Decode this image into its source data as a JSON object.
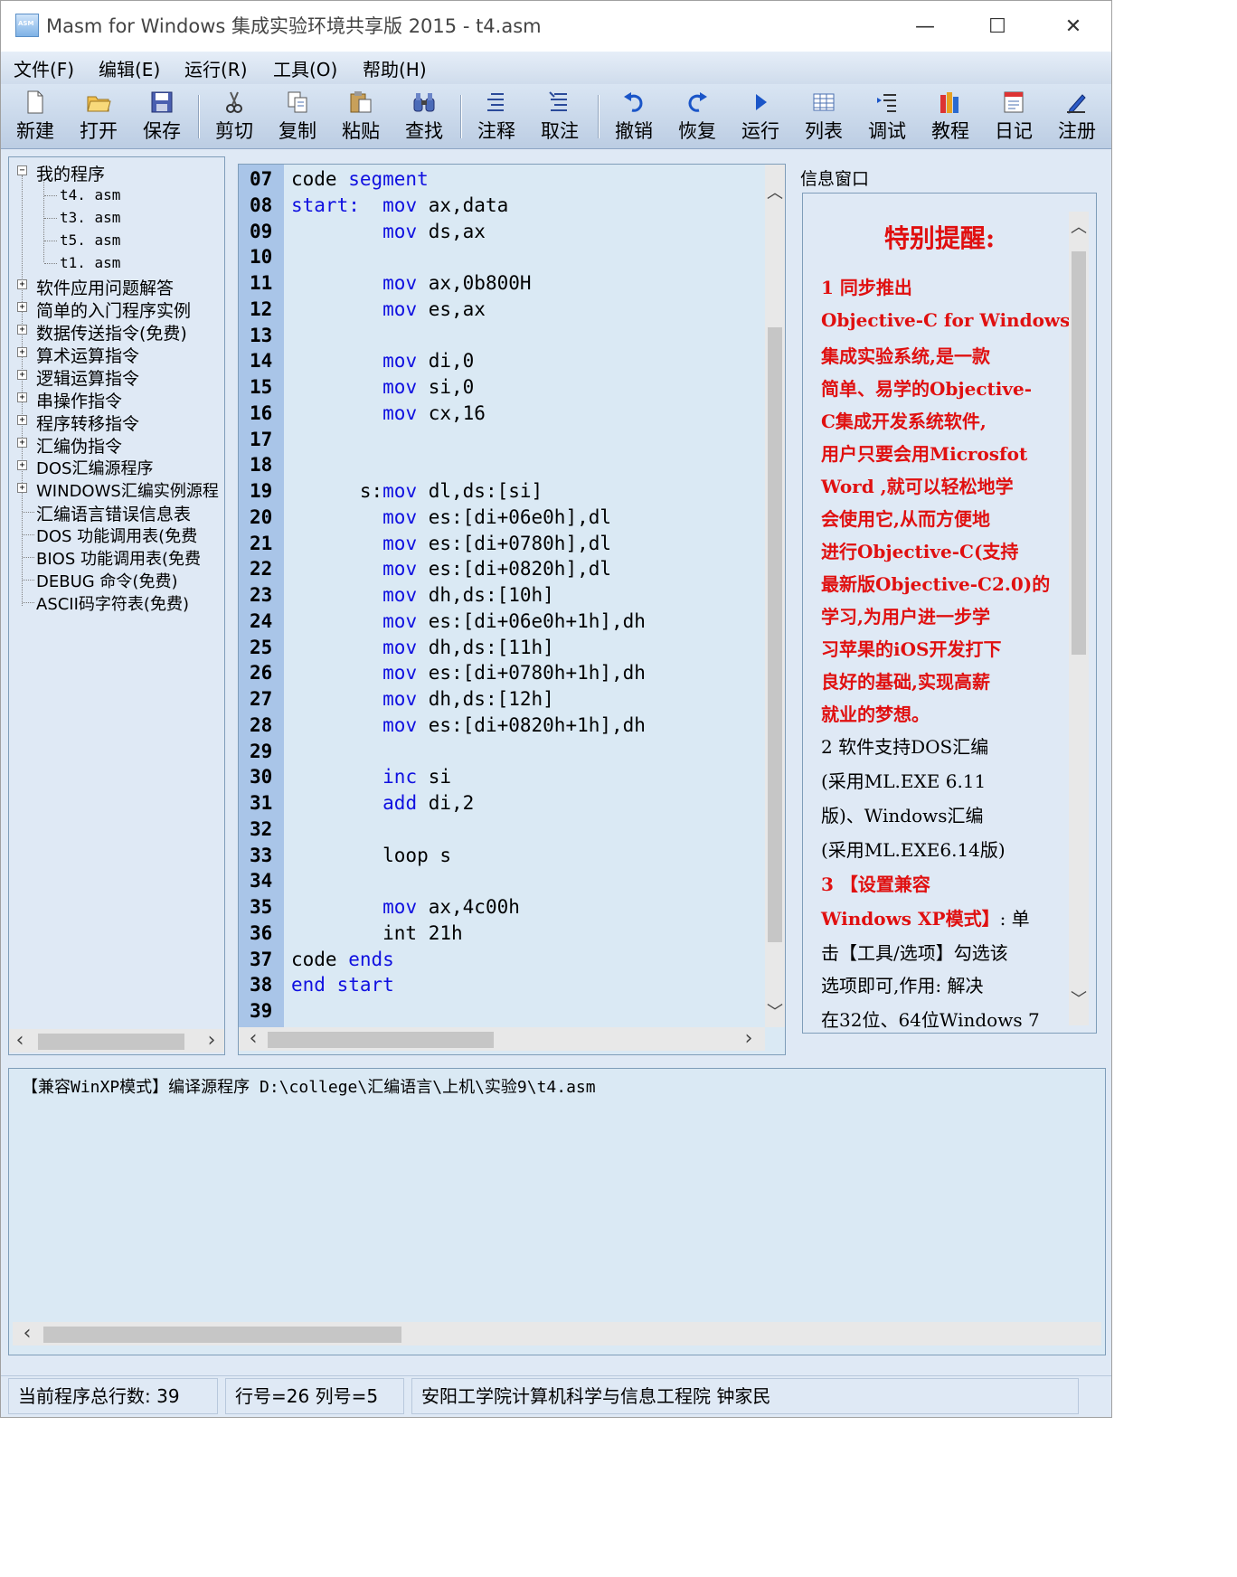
{
  "window": {
    "title": "Masm for Windows 集成实验环境共享版 2015 - t4.asm",
    "icon_text": "ASM",
    "controls": {
      "minimize": "—",
      "maximize": "☐",
      "close": "✕"
    }
  },
  "menu": [
    "文件(F)",
    "编辑(E)",
    "运行(R)",
    "工具(O)",
    "帮助(H)"
  ],
  "toolbar": [
    {
      "label": "新建",
      "icon": "new-file-icon"
    },
    {
      "label": "打开",
      "icon": "open-folder-icon"
    },
    {
      "label": "保存",
      "icon": "save-disk-icon"
    },
    {
      "label": "剪切",
      "icon": "scissors-icon"
    },
    {
      "label": "复制",
      "icon": "copy-icon"
    },
    {
      "label": "粘贴",
      "icon": "paste-icon"
    },
    {
      "label": "查找",
      "icon": "binoculars-icon"
    },
    {
      "label": "注释",
      "icon": "comment-icon"
    },
    {
      "label": "取注",
      "icon": "uncomment-icon"
    },
    {
      "label": "撤销",
      "icon": "undo-icon"
    },
    {
      "label": "恢复",
      "icon": "redo-icon"
    },
    {
      "label": "运行",
      "icon": "run-icon"
    },
    {
      "label": "列表",
      "icon": "list-icon"
    },
    {
      "label": "调试",
      "icon": "debug-icon"
    },
    {
      "label": "教程",
      "icon": "books-icon"
    },
    {
      "label": "日记",
      "icon": "diary-icon"
    },
    {
      "label": "注册",
      "icon": "register-pen-icon"
    }
  ],
  "tree": {
    "root": "我的程序",
    "files": [
      "t4. asm",
      "t3. asm",
      "t5. asm",
      "t1. asm"
    ],
    "folders": [
      "软件应用问题解答",
      "简单的入门程序实例",
      "数据传送指令(免费)",
      "算术运算指令",
      "逻辑运算指令",
      "串操作指令",
      "程序转移指令",
      "汇编伪指令",
      "DOS汇编源程序",
      "WINDOWS汇编实例源程"
    ],
    "leaves": [
      "汇编语言错误信息表",
      "DOS 功能调用表(免费",
      "BIOS 功能调用表(免费",
      "DEBUG 命令(免费)",
      "ASCII码字符表(免费)"
    ]
  },
  "editor": {
    "lines": [
      {
        "n": "07",
        "t": [
          [
            "code ",
            ""
          ],
          [
            "segment",
            "kw"
          ]
        ]
      },
      {
        "n": "08",
        "t": [
          [
            "start:",
            "kw"
          ],
          [
            "  ",
            ""
          ],
          [
            "mov",
            "kw"
          ],
          [
            " ax,data",
            ""
          ]
        ]
      },
      {
        "n": "09",
        "t": [
          [
            "        ",
            ""
          ],
          [
            "mov",
            "kw"
          ],
          [
            " ds,ax",
            ""
          ]
        ]
      },
      {
        "n": "10",
        "t": []
      },
      {
        "n": "11",
        "t": [
          [
            "        ",
            ""
          ],
          [
            "mov",
            "kw"
          ],
          [
            " ax,0b800H",
            ""
          ]
        ]
      },
      {
        "n": "12",
        "t": [
          [
            "        ",
            ""
          ],
          [
            "mov",
            "kw"
          ],
          [
            " es,ax",
            ""
          ]
        ]
      },
      {
        "n": "13",
        "t": []
      },
      {
        "n": "14",
        "t": [
          [
            "        ",
            ""
          ],
          [
            "mov",
            "kw"
          ],
          [
            " di,0",
            ""
          ]
        ]
      },
      {
        "n": "15",
        "t": [
          [
            "        ",
            ""
          ],
          [
            "mov",
            "kw"
          ],
          [
            " si,0",
            ""
          ]
        ]
      },
      {
        "n": "16",
        "t": [
          [
            "        ",
            ""
          ],
          [
            "mov",
            "kw"
          ],
          [
            " cx,16",
            ""
          ]
        ]
      },
      {
        "n": "17",
        "t": []
      },
      {
        "n": "18",
        "t": []
      },
      {
        "n": "19",
        "t": [
          [
            "      s:",
            ""
          ],
          [
            "mov",
            "kw"
          ],
          [
            " dl,ds:[si]",
            ""
          ]
        ]
      },
      {
        "n": "20",
        "t": [
          [
            "        ",
            ""
          ],
          [
            "mov",
            "kw"
          ],
          [
            " es:[di+06e0h],dl",
            ""
          ]
        ]
      },
      {
        "n": "21",
        "t": [
          [
            "        ",
            ""
          ],
          [
            "mov",
            "kw"
          ],
          [
            " es:[di+0780h],dl",
            ""
          ]
        ]
      },
      {
        "n": "22",
        "t": [
          [
            "        ",
            ""
          ],
          [
            "mov",
            "kw"
          ],
          [
            " es:[di+0820h],dl",
            ""
          ]
        ]
      },
      {
        "n": "23",
        "t": [
          [
            "        ",
            ""
          ],
          [
            "mov",
            "kw"
          ],
          [
            " dh,ds:[10h]",
            ""
          ]
        ]
      },
      {
        "n": "24",
        "t": [
          [
            "        ",
            ""
          ],
          [
            "mov",
            "kw"
          ],
          [
            " es:[di+06e0h+1h],dh",
            ""
          ]
        ]
      },
      {
        "n": "25",
        "t": [
          [
            "        ",
            ""
          ],
          [
            "mov",
            "kw"
          ],
          [
            " dh,ds:[11h]",
            ""
          ]
        ]
      },
      {
        "n": "26",
        "t": [
          [
            "        ",
            ""
          ],
          [
            "mov",
            "kw"
          ],
          [
            " es:[di+0780h+1h],dh",
            ""
          ]
        ]
      },
      {
        "n": "27",
        "t": [
          [
            "        ",
            ""
          ],
          [
            "mov",
            "kw"
          ],
          [
            " dh,ds:[12h]",
            ""
          ]
        ]
      },
      {
        "n": "28",
        "t": [
          [
            "        ",
            ""
          ],
          [
            "mov",
            "kw"
          ],
          [
            " es:[di+0820h+1h],dh",
            ""
          ]
        ]
      },
      {
        "n": "29",
        "t": []
      },
      {
        "n": "30",
        "t": [
          [
            "        ",
            ""
          ],
          [
            "inc",
            "kw"
          ],
          [
            " si",
            ""
          ]
        ]
      },
      {
        "n": "31",
        "t": [
          [
            "        ",
            ""
          ],
          [
            "add",
            "kw"
          ],
          [
            " di,2",
            ""
          ]
        ]
      },
      {
        "n": "32",
        "t": []
      },
      {
        "n": "33",
        "t": [
          [
            "        loop s",
            ""
          ]
        ]
      },
      {
        "n": "34",
        "t": []
      },
      {
        "n": "35",
        "t": [
          [
            "        ",
            ""
          ],
          [
            "mov",
            "kw"
          ],
          [
            " ax,4c00h",
            ""
          ]
        ]
      },
      {
        "n": "36",
        "t": [
          [
            "        int 21h",
            ""
          ]
        ]
      },
      {
        "n": "37",
        "t": [
          [
            "code ",
            ""
          ],
          [
            "ends",
            "kw"
          ]
        ]
      },
      {
        "n": "38",
        "t": [
          [
            "end",
            "kw"
          ],
          [
            " ",
            ""
          ],
          [
            "start",
            "kw"
          ]
        ]
      },
      {
        "n": "39",
        "t": []
      }
    ]
  },
  "info": {
    "label": "信息窗口",
    "title": "特别提醒:",
    "lines": [
      {
        "t": "    1  同步推出",
        "c": "red"
      },
      {
        "t": "Objective-C for Windows",
        "c": "red"
      },
      {
        "t": "集成实验系统,是一款",
        "c": "red"
      },
      {
        "t": "简单、易学的Objective-",
        "c": "red"
      },
      {
        "t": "C集成开发系统软件,",
        "c": "red"
      },
      {
        "t": "用户只要会用Microsfot",
        "c": "red"
      },
      {
        "t": "Word ,就可以轻松地学",
        "c": "red"
      },
      {
        "t": "会使用它,从而方便地",
        "c": "red"
      },
      {
        "t": "进行Objective-C(支持",
        "c": "red"
      },
      {
        "t": "最新版Objective-C2.0)的",
        "c": "red"
      },
      {
        "t": "学习,为用户进一步学",
        "c": "red"
      },
      {
        "t": "习苹果的iOS开发打下",
        "c": "red"
      },
      {
        "t": "良好的基础,实现高薪",
        "c": "red"
      },
      {
        "t": "就业的梦想。",
        "c": "red"
      },
      {
        "t": "     2 软件支持DOS汇编",
        "c": "blk"
      },
      {
        "t": "(采用ML.EXE 6.11",
        "c": "blk"
      },
      {
        "t": "版)、Windows汇编",
        "c": "blk"
      },
      {
        "t": "(采用ML.EXE6.14版)",
        "c": "blk"
      },
      {
        "t": "     3 【设置兼容",
        "c": "red"
      },
      {
        "t": "Windows XP模式】: 单",
        "c": "mix"
      },
      {
        "t": "击【工具/选项】勾选该",
        "c": "blk"
      },
      {
        "t": "选项即可,作用: 解决",
        "c": "blk"
      },
      {
        "t": "在32位、64位Windows 7",
        "c": "blk"
      }
    ]
  },
  "output": {
    "text": "【兼容WinXP模式】编译源程序 D:\\college\\汇编语言\\上机\\实验9\\t4.asm"
  },
  "status": {
    "total_label": "当前程序总行数: ",
    "total_value": "39",
    "position": "行号=26   列号=5",
    "credit": "安阳工学院计算机科学与信息工程院    钟家民"
  }
}
